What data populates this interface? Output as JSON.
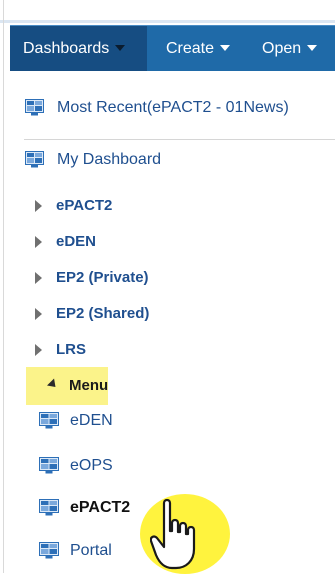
{
  "menubar": {
    "dashboards_label": "Dashboards",
    "create_label": "Create",
    "open_label": "Open"
  },
  "dropdown": {
    "most_recent_label": "Most Recent(ePACT2 - 01News)",
    "my_dashboard_label": "My Dashboard",
    "folders": [
      {
        "label": "ePACT2"
      },
      {
        "label": "eDEN"
      },
      {
        "label": "EP2 (Private)"
      },
      {
        "label": "EP2 (Shared)"
      },
      {
        "label": "LRS"
      }
    ],
    "menu_folder_label": "Menu",
    "menu_items": [
      {
        "label": "eDEN"
      },
      {
        "label": "eOPS"
      },
      {
        "label": "ePACT2"
      },
      {
        "label": "Portal"
      }
    ]
  },
  "colors": {
    "menubar_bg": "#1f6aa8",
    "menubar_active_bg": "#164d82",
    "link_blue": "#1f4f8f",
    "highlight_yellow": "#fbf38a",
    "pointer_glow": "#fff22e"
  },
  "icons": {
    "dashboard_icon": "dashboard-icon",
    "expand_icon": "triangle-right-icon",
    "collapse_icon": "triangle-down-icon",
    "pointer": "hand-pointer-icon"
  }
}
